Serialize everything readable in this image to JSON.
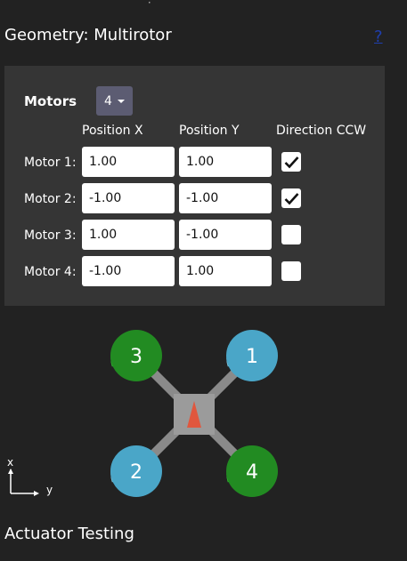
{
  "geometry": {
    "title": "Geometry: Multirotor",
    "help_link": "?"
  },
  "motors_panel": {
    "label": "Motors",
    "count": "4",
    "headers": {
      "x": "Position X",
      "y": "Position Y",
      "ccw": "Direction CCW"
    },
    "rows": [
      {
        "label": "Motor 1:",
        "x": "1.00",
        "y": "1.00",
        "ccw": true
      },
      {
        "label": "Motor 2:",
        "x": "-1.00",
        "y": "-1.00",
        "ccw": true
      },
      {
        "label": "Motor 3:",
        "x": "1.00",
        "y": "-1.00",
        "ccw": false
      },
      {
        "label": "Motor 4:",
        "x": "-1.00",
        "y": "1.00",
        "ccw": false
      }
    ]
  },
  "diagram": {
    "motors": [
      {
        "number": "1",
        "color": "#4aa6c8"
      },
      {
        "number": "2",
        "color": "#4aa6c8"
      },
      {
        "number": "3",
        "color": "#228b22"
      },
      {
        "number": "4",
        "color": "#228b22"
      }
    ],
    "axis_x": "x",
    "axis_y": "y"
  },
  "actuator": {
    "title": "Actuator Testing"
  }
}
